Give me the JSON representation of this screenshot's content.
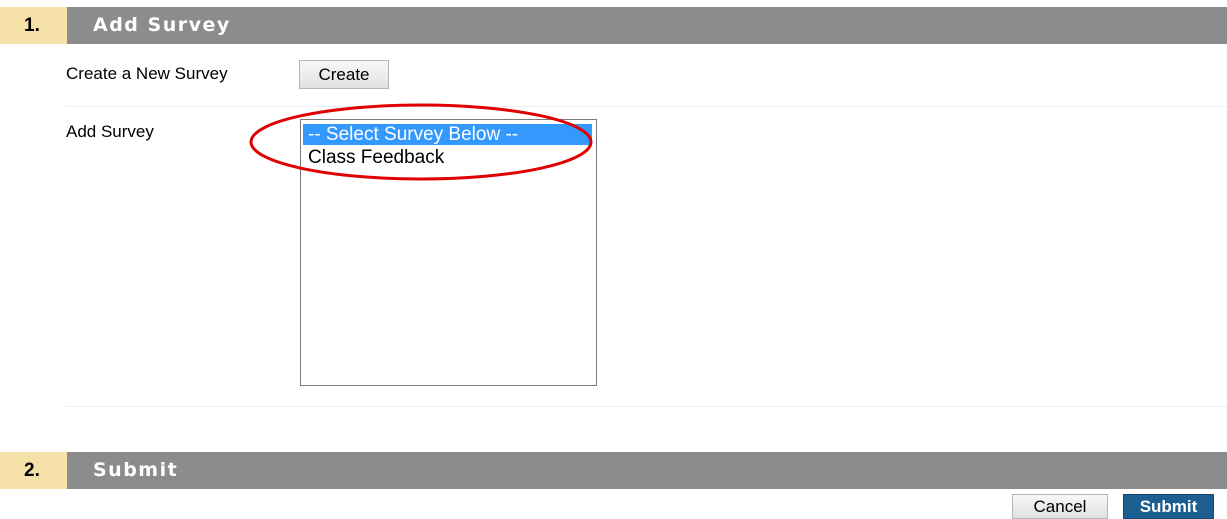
{
  "section1": {
    "number": "1.",
    "title": "Add Survey",
    "create_label": "Create a New Survey",
    "create_button": "Create",
    "add_label": "Add Survey",
    "survey_list": {
      "options": [
        "-- Select Survey Below --",
        "Class Feedback"
      ],
      "selected": "-- Select Survey Below --"
    }
  },
  "section2": {
    "number": "2.",
    "title": "Submit",
    "cancel_button": "Cancel",
    "submit_button": "Submit"
  },
  "colors": {
    "header_bar": "#8c8c8c",
    "step_badge": "#f6e2a9",
    "selected_option": "#3399ff",
    "submit_button": "#1b5e8f",
    "annotation": "#e00000"
  }
}
